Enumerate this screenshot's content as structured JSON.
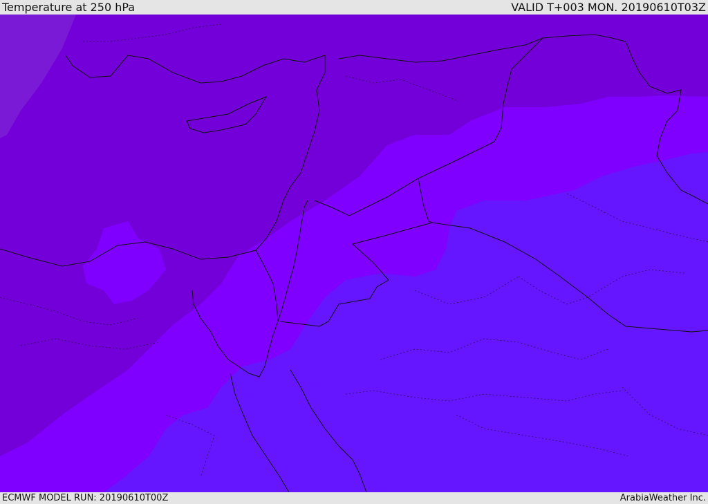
{
  "header": {
    "title": "Temperature at 250 hPa",
    "valid_label": "VALID T+003 MON. 20190610T03Z"
  },
  "footer": {
    "model_run": "ECMWF MODEL RUN: 20190610T00Z",
    "credit": "ArabiaWeather Inc."
  },
  "colors": {
    "band_warmest": "#7400d9",
    "band_middle": "#7f00ff",
    "band_coolest": "#6516ff",
    "band_far_northwest": "#7a1ad6",
    "border_line": "#111111"
  }
}
